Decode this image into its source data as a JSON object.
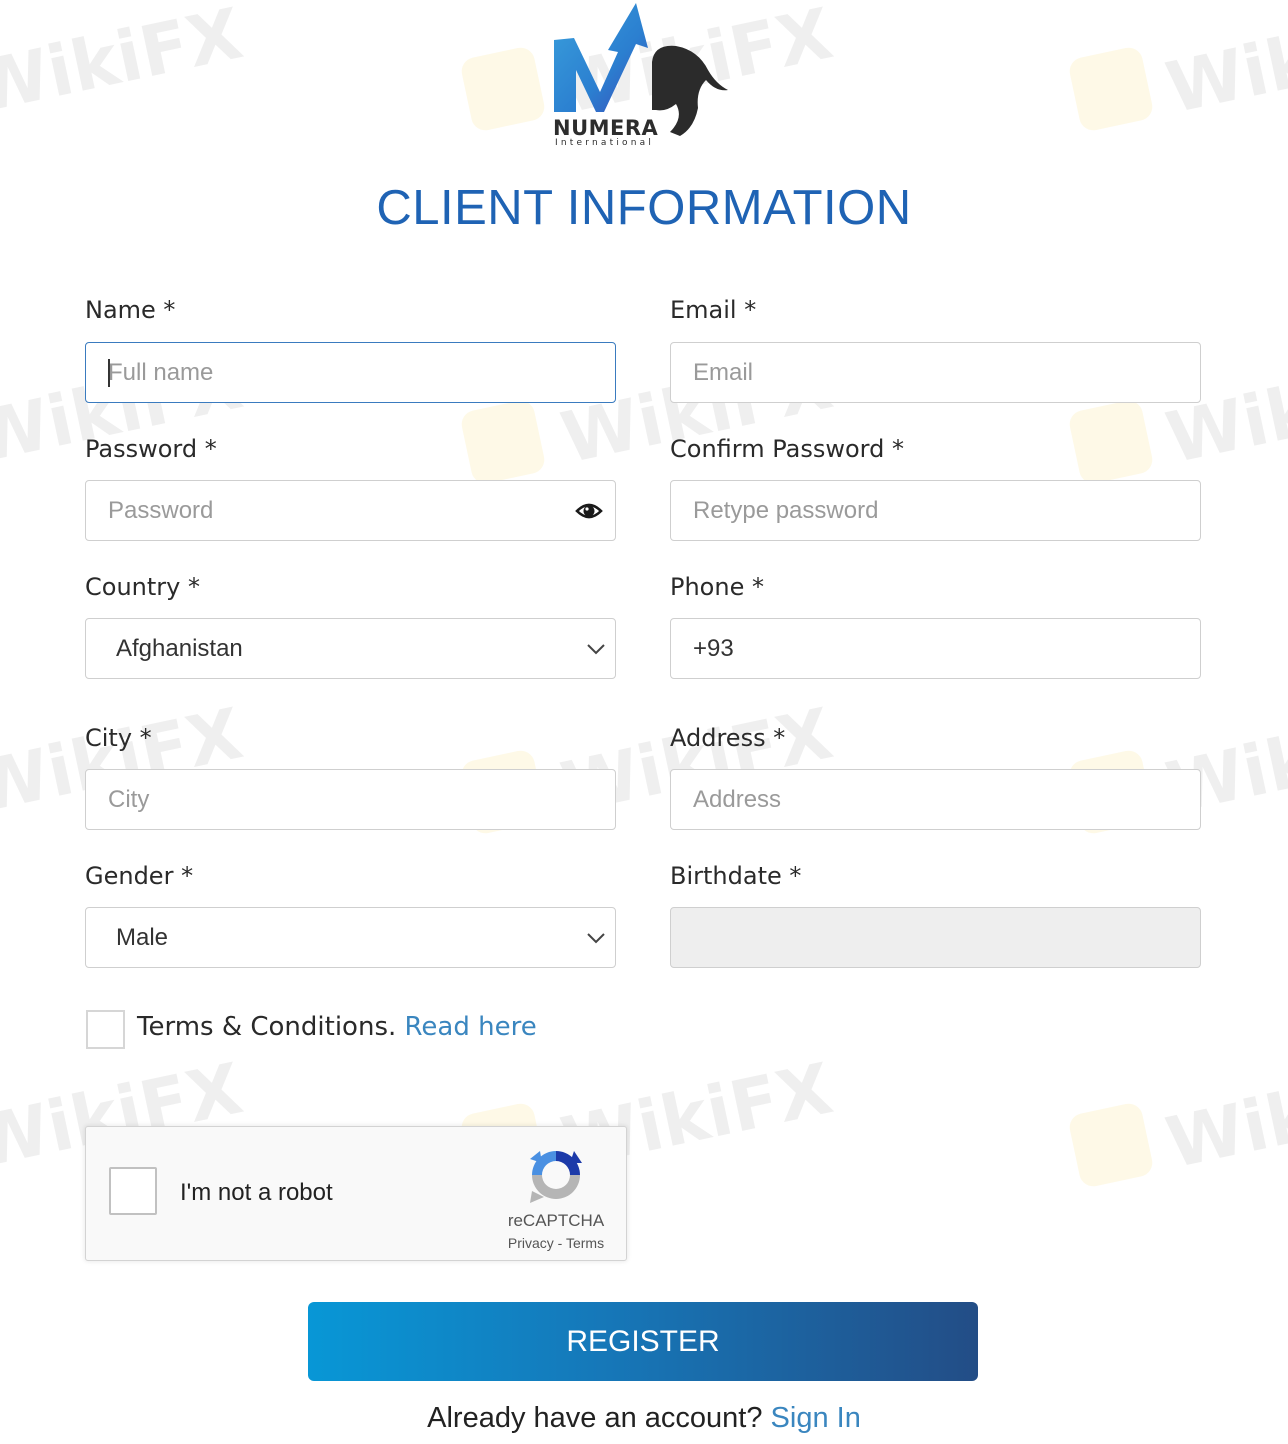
{
  "brand": {
    "name": "NUMERA",
    "subtitle": "International"
  },
  "page_title": "CLIENT INFORMATION",
  "form": {
    "name": {
      "label": "Name *",
      "placeholder": "Full name"
    },
    "email": {
      "label": "Email *",
      "placeholder": "Email"
    },
    "password": {
      "label": "Password *",
      "placeholder": "Password",
      "toggle_icon": "eye-icon"
    },
    "confirm_password": {
      "label": "Confirm Password *",
      "placeholder": "Retype password"
    },
    "country": {
      "label": "Country *",
      "selected": "Afghanistan"
    },
    "phone": {
      "label": "Phone *",
      "value": "+93"
    },
    "city": {
      "label": "City *",
      "placeholder": "City"
    },
    "address": {
      "label": "Address *",
      "placeholder": "Address"
    },
    "gender": {
      "label": "Gender *",
      "selected": "Male"
    },
    "birthdate": {
      "label": "Birthdate *",
      "value": ""
    }
  },
  "terms": {
    "text": "Terms & Conditions. ",
    "link": "Read here",
    "checked": false
  },
  "recaptcha": {
    "label": "I'm not a robot",
    "brand": "reCAPTCHA",
    "privacy": "Privacy",
    "separator": " - ",
    "terms": "Terms"
  },
  "register_button": "REGISTER",
  "signin": {
    "prompt": "Already have an account? ",
    "link": "Sign In"
  },
  "watermark_text": "WikiFX",
  "colors": {
    "title": "#1f63b4",
    "link": "#3a86bf",
    "button_start": "#0897d6",
    "button_end": "#234d86"
  }
}
